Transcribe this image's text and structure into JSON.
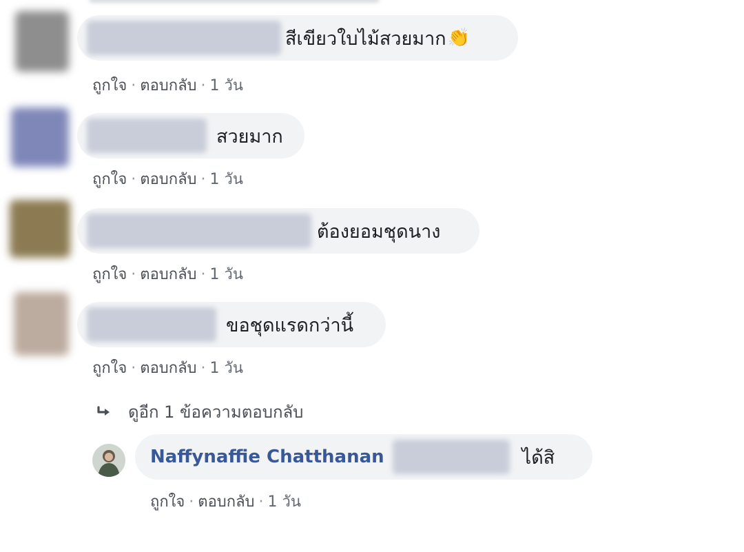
{
  "comments": [
    {
      "text": "สีเขียวใบไม้สวยมาก",
      "emoji": "👏",
      "avatar_color": "#8a8a8a",
      "actions": {
        "like": "ถูกใจ",
        "reply": "ตอบกลับ",
        "time": "1 วัน"
      }
    },
    {
      "text": "สวยมาก",
      "avatar_color": "#7a82b4",
      "actions": {
        "like": "ถูกใจ",
        "reply": "ตอบกลับ",
        "time": "1 วัน"
      }
    },
    {
      "text": "ต้องยอมชุดนาง",
      "avatar_color": "#8a7a55",
      "actions": {
        "like": "ถูกใจ",
        "reply": "ตอบกลับ",
        "time": "1 วัน"
      }
    },
    {
      "text": "ขอชุดแรดกว่านี้",
      "avatar_color": "#b8a59c",
      "actions": {
        "like": "ถูกใจ",
        "reply": "ตอบกลับ",
        "time": "1 วัน"
      }
    }
  ],
  "view_more": "ดูอีก 1 ข้อความตอบกลับ",
  "reply": {
    "author": "Naffynaffie Chatthanan",
    "text": "ได้สิ",
    "actions": {
      "like": "ถูกใจ",
      "reply": "ตอบกลับ",
      "time": "1 วัน"
    }
  },
  "colors": {
    "bubble": "#f2f3f5",
    "author": "#385898",
    "meta": "#606770"
  }
}
